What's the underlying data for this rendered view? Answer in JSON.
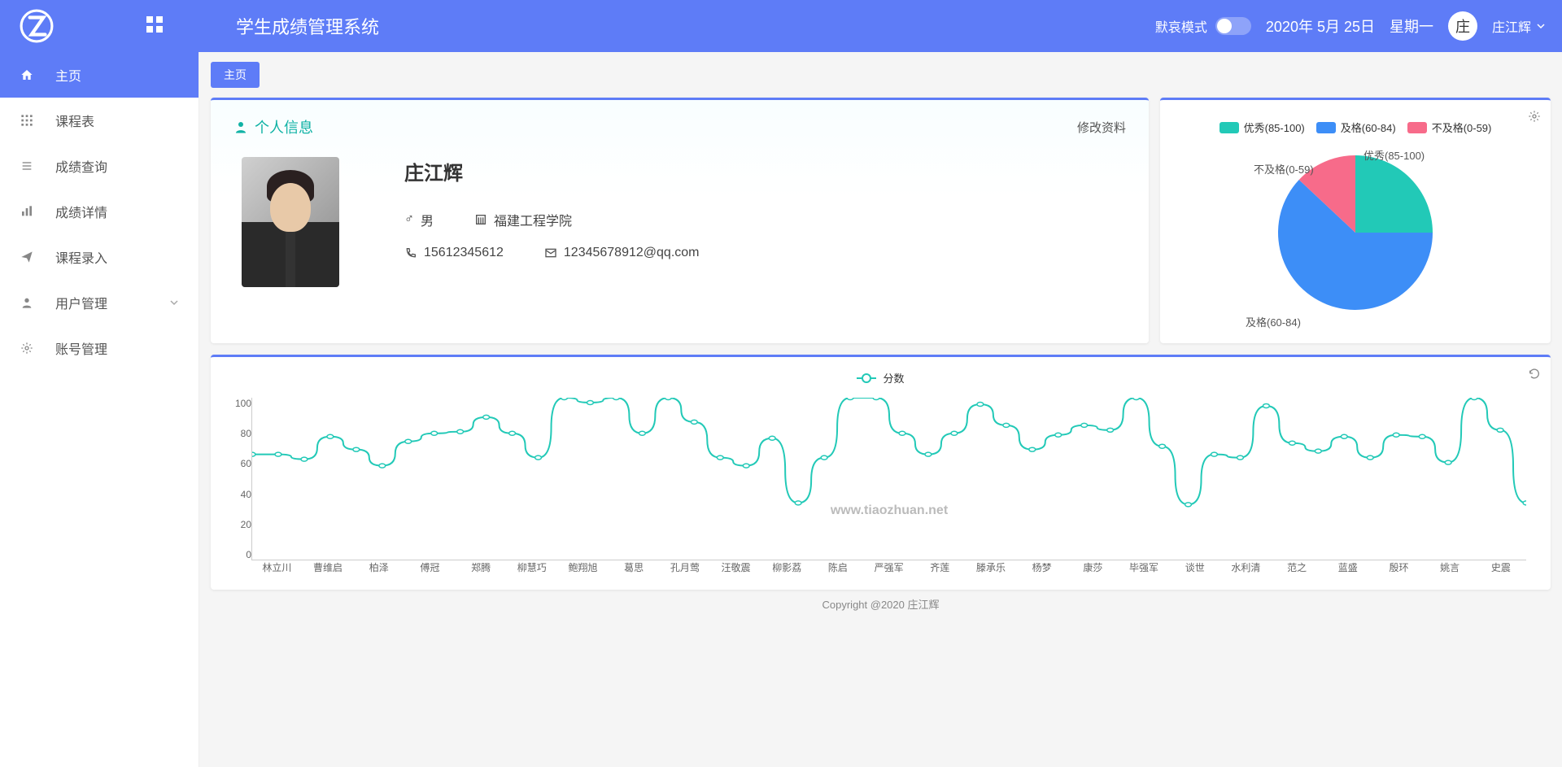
{
  "header": {
    "app_title": "学生成绩管理系统",
    "mourning_label": "默哀模式",
    "date_text": "2020年 5月 25日",
    "weekday": "星期一",
    "avatar_char": "庄",
    "username": "庄江辉"
  },
  "sidebar": {
    "items": [
      {
        "label": "主页",
        "icon": "home"
      },
      {
        "label": "课程表",
        "icon": "grid"
      },
      {
        "label": "成绩查询",
        "icon": "list"
      },
      {
        "label": "成绩详情",
        "icon": "bars"
      },
      {
        "label": "课程录入",
        "icon": "send"
      },
      {
        "label": "用户管理",
        "icon": "user",
        "chevron": true
      },
      {
        "label": "账号管理",
        "icon": "gear"
      }
    ],
    "active_index": 0
  },
  "tab": {
    "label": "主页"
  },
  "info": {
    "title": "个人信息",
    "edit": "修改资料",
    "name": "庄江辉",
    "gender": "男",
    "school": "福建工程学院",
    "phone": "15612345612",
    "email": "12345678912@qq.com"
  },
  "chart_data": [
    {
      "id": "pie",
      "type": "pie",
      "legend": [
        "优秀(85-100)",
        "及格(60-84)",
        "不及格(0-59)"
      ],
      "labels": [
        "优秀(85-100)",
        "及格(60-84)",
        "不及格(0-59)"
      ],
      "values": [
        25,
        62,
        13
      ],
      "colors": [
        "#22c9b7",
        "#3d8ef7",
        "#f76b8a"
      ]
    },
    {
      "id": "line",
      "type": "line",
      "series_name": "分数",
      "ylim": [
        0,
        100
      ],
      "yticks": [
        0,
        20,
        40,
        60,
        80,
        100
      ],
      "categories": [
        "林立川",
        "曹维启",
        "柏泽",
        "傅冠",
        "郑腾",
        "柳慧巧",
        "鲍翔旭",
        "葛思",
        "孔月莺",
        "汪敬震",
        "柳影荔",
        "陈启",
        "严强军",
        "齐莲",
        "滕承乐",
        "杨梦",
        "康莎",
        "毕强军",
        "谈世",
        "水利清",
        "范之",
        "蓝盛",
        "殷环",
        "姚言",
        "史震"
      ],
      "values": [
        65,
        65,
        62,
        76,
        68,
        58,
        73,
        78,
        79,
        88,
        78,
        63,
        100,
        97,
        100,
        78,
        100,
        85,
        63,
        58,
        75,
        35,
        63,
        100,
        100,
        78,
        65,
        78,
        96,
        83,
        68,
        77,
        83,
        80,
        100,
        70,
        34,
        65,
        63,
        95,
        72,
        67,
        76,
        63,
        77,
        76,
        60,
        100,
        80,
        35
      ]
    }
  ],
  "footer": {
    "copyright": "Copyright @2020 庄江辉"
  },
  "watermark": "www.tiaozhuan.net"
}
